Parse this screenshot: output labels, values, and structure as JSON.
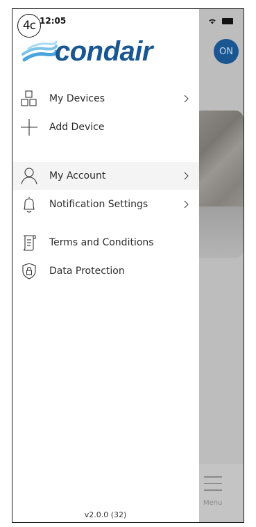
{
  "status_bar": {
    "badge": "4c",
    "time": "12:05"
  },
  "brand": {
    "name": "condair",
    "color": "#1a5690"
  },
  "menu": {
    "items": [
      {
        "label": "My Devices",
        "icon": "devices-grid-icon",
        "chevron": true
      },
      {
        "label": "Add Device",
        "icon": "plus-icon",
        "chevron": false
      },
      {
        "label": "My Account",
        "icon": "person-icon",
        "chevron": true,
        "active": true
      },
      {
        "label": "Notification Settings",
        "icon": "bell-icon",
        "chevron": true
      },
      {
        "label": "Terms and Conditions",
        "icon": "document-icon",
        "chevron": false
      },
      {
        "label": "Data Protection",
        "icon": "shield-lock-icon",
        "chevron": false
      }
    ]
  },
  "version": "v2.0.0 (32)",
  "background_app": {
    "power_button_label": "ON",
    "bottom_nav_label": "Menu"
  }
}
